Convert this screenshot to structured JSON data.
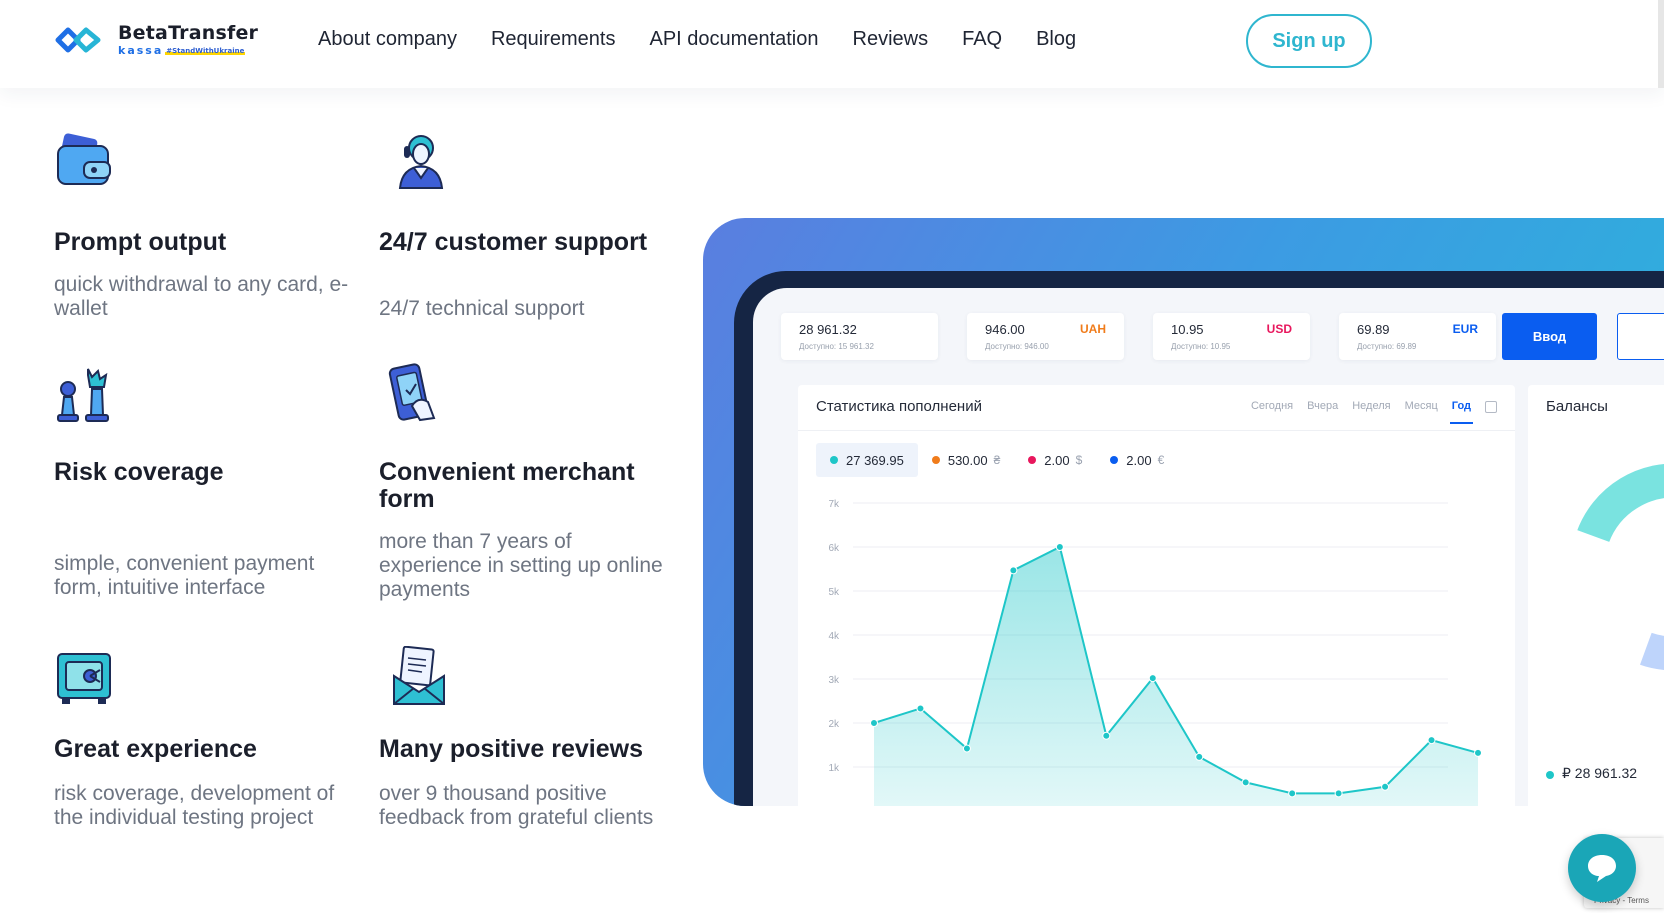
{
  "header": {
    "logo": {
      "name": "BetaTransfer",
      "sub": "kassa",
      "tag": "#StandWithUkraine"
    },
    "nav": [
      "About company",
      "Requirements",
      "API documentation",
      "Reviews",
      "FAQ",
      "Blog"
    ],
    "signup_label": "Sign up"
  },
  "features": [
    {
      "icon": "wallet-icon",
      "title": "Prompt output",
      "description": "quick withdrawal to any card, e-wallet"
    },
    {
      "icon": "support-agent-icon",
      "title": "24/7 customer support",
      "description": "24/7 technical support"
    },
    {
      "icon": "chess-pieces-icon",
      "title": "Risk coverage",
      "description": "simple, convenient payment form, intuitive interface"
    },
    {
      "icon": "mobile-payment-icon",
      "title": "Convenient merchant form",
      "description": "more than 7 years of experience in setting up online payments"
    },
    {
      "icon": "safe-icon",
      "title": "Great experience",
      "description": "risk coverage, development of the individual testing project"
    },
    {
      "icon": "envelope-letter-icon",
      "title": "Many positive reviews",
      "description": "over 9 thousand positive feedback from grateful clients"
    }
  ],
  "dashboard": {
    "balances": [
      {
        "amount": "28 961.32",
        "currency": "",
        "available": "Доступно: 15 961.32",
        "color": "#242a38"
      },
      {
        "amount": "946.00",
        "currency": "UAH",
        "available": "Доступно: 946.00",
        "color": "#f07c1b"
      },
      {
        "amount": "10.95",
        "currency": "USD",
        "available": "Доступно: 10.95",
        "color": "#e8175d"
      },
      {
        "amount": "69.89",
        "currency": "EUR",
        "available": "Доступно: 69.89",
        "color": "#0a5df0"
      }
    ],
    "deposit_label": "Ввод",
    "stats_title": "Статистика пополнений",
    "periods": [
      "Сегодня",
      "Вчера",
      "Неделя",
      "Месяц",
      "Год"
    ],
    "active_period": "Год",
    "legend": [
      {
        "value": "27 369.95",
        "symbol": "",
        "color": "#1ec6c8"
      },
      {
        "value": "530.00",
        "symbol": "₴",
        "color": "#f07c1b"
      },
      {
        "value": "2.00",
        "symbol": "$",
        "color": "#e8175d"
      },
      {
        "value": "2.00",
        "symbol": "€",
        "color": "#0a5df0"
      }
    ],
    "balances_title": "Балансы",
    "balances_total": "₽ 28 961.32"
  },
  "chart_data": {
    "type": "area",
    "title": "Статистика пополнений",
    "xlabel": "",
    "ylabel": "",
    "y_tick_labels": [
      "1k",
      "2k",
      "3k",
      "4k",
      "5k",
      "6k",
      "7k"
    ],
    "ylim": [
      1000,
      7000
    ],
    "grid": true,
    "color": "#1ec6c8",
    "series": [
      {
        "values": [
          2000,
          2330,
          1420,
          5470,
          6000,
          1710,
          3020,
          1230,
          650,
          400,
          400,
          550,
          1610,
          1320
        ]
      }
    ]
  },
  "pie_colors": [
    "#7ae3e0",
    "#ffd9bd",
    "#f6b3d6",
    "#bed4fb"
  ],
  "recaptcha_text": "Privacy - Terms"
}
